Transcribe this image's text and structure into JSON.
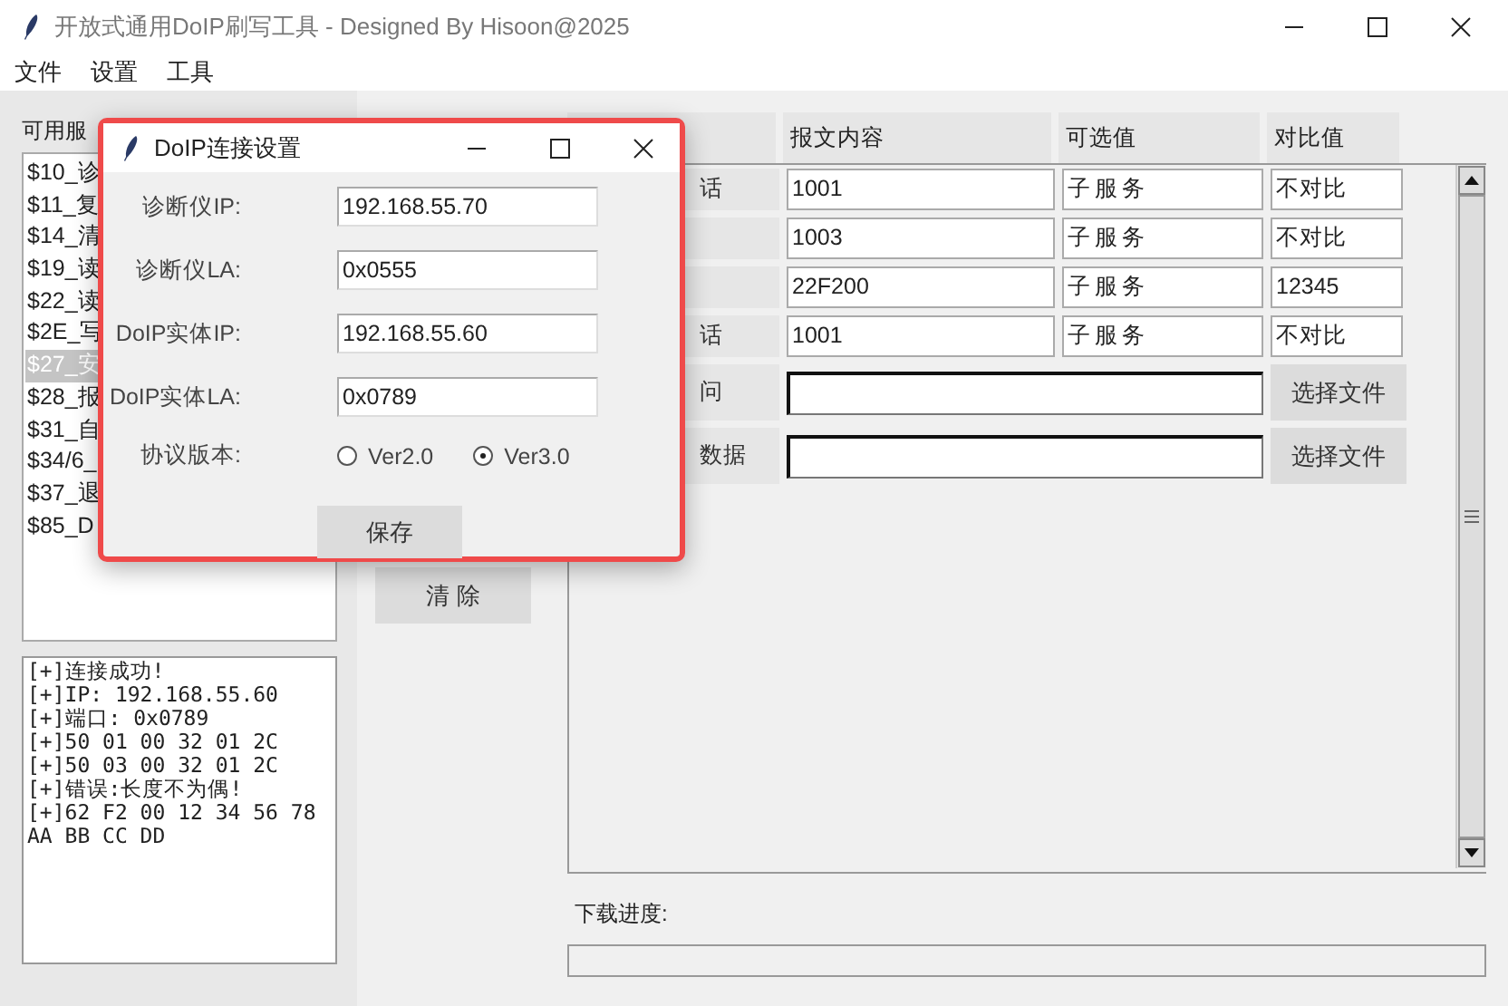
{
  "window": {
    "title": "开放式通用DoIP刷写工具 - Designed By Hisoon@2025"
  },
  "menu": [
    "文件",
    "设置",
    "工具"
  ],
  "services": {
    "label": "可用服",
    "items": [
      {
        "text": "$10_诊",
        "selected": false
      },
      {
        "text": "$11_复",
        "selected": false
      },
      {
        "text": "$14_清",
        "selected": false
      },
      {
        "text": "$19_读",
        "selected": false
      },
      {
        "text": "$22_读",
        "selected": false
      },
      {
        "text": "$2E_写",
        "selected": false
      },
      {
        "text": "$27_安",
        "selected": true
      },
      {
        "text": "$28_报",
        "selected": false
      },
      {
        "text": "$31_自",
        "selected": false
      },
      {
        "text": "$34/6_",
        "selected": false
      },
      {
        "text": "$37_退",
        "selected": false
      },
      {
        "text": "$85_D",
        "selected": false
      }
    ]
  },
  "log": [
    "[+]连接成功!",
    "[+]IP: 192.168.55.60",
    "[+]端口: 0x0789",
    "[+]50 01 00 32 01 2C",
    "[+]50 03 00 32 01 2C",
    "[+]错误:长度不为偶!",
    "[+]62 F2 00 12 34 56 78",
    "AA BB CC DD"
  ],
  "clear_button": "清 除",
  "table": {
    "columns": [
      "报文内容",
      "可选值",
      "对比值"
    ],
    "rows": [
      {
        "kind": "entry",
        "label": "话",
        "content": "1001",
        "option": "子服务",
        "compare": "不对比"
      },
      {
        "kind": "entry",
        "content": "1003",
        "option": "子服务",
        "compare": "不对比"
      },
      {
        "kind": "entry",
        "content": "22F200",
        "option": "子服务",
        "compare": "12345"
      },
      {
        "kind": "entry",
        "label": "话",
        "content": "1001",
        "option": "子服务",
        "compare": "不对比"
      },
      {
        "kind": "file",
        "label": "问",
        "button": "选择文件"
      },
      {
        "kind": "file",
        "label": "数据",
        "button": "选择文件"
      }
    ]
  },
  "progress": {
    "label": "下载进度:",
    "level": 0
  },
  "dialog": {
    "title": "DoIP连接设置",
    "fields": [
      {
        "label": "诊断仪IP:",
        "value": "192.168.55.70"
      },
      {
        "label": "诊断仪LA:",
        "value": "0x0555"
      },
      {
        "label": "DoIP实体IP:",
        "value": "192.168.55.60"
      },
      {
        "label": "DoIP实体LA:",
        "value": "0x0789"
      }
    ],
    "protocol": {
      "label": "协议版本:",
      "options": [
        {
          "label": "Ver2.0",
          "selected": false
        },
        {
          "label": "Ver3.0",
          "selected": true
        }
      ]
    },
    "save_button": "保存"
  }
}
